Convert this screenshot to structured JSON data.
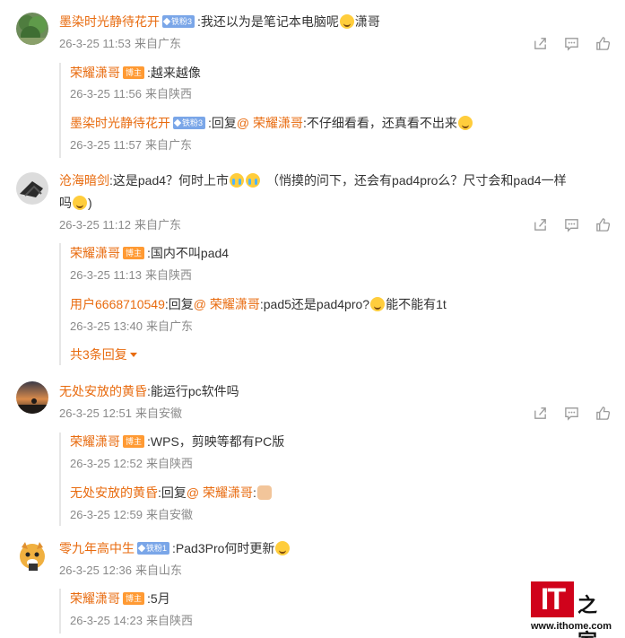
{
  "comments": [
    {
      "user": "墨染时光静待花开",
      "badge": "铁粉3",
      "text": "我还以为是笔记本电脑呢",
      "text_after": "潇哥",
      "time": "26-3-25 11:53",
      "location": "来自广东",
      "replies": [
        {
          "user": "荣耀潇哥",
          "badge": "博主",
          "text": "越来越像",
          "time": "26-3-25 11:56",
          "location": "来自陕西"
        },
        {
          "user": "墨染时光静待花开",
          "badge": "铁粉3",
          "reply_word": "回复",
          "mention": "@ 荣耀潇哥",
          "text": "不仔细看看，还真看不出来",
          "time": "26-3-25 11:57",
          "location": "来自广东"
        }
      ]
    },
    {
      "user": "沧海暗剑",
      "text": "这是pad4？何时上市",
      "text_after": "（悄摸的问下，还会有pad4pro么？尺寸会和pad4一样",
      "text_line2": "吗",
      "text_line2_after": ")",
      "time": "26-3-25 11:12",
      "location": "来自广东",
      "replies": [
        {
          "user": "荣耀潇哥",
          "badge": "博主",
          "text": "国内不叫pad4",
          "time": "26-3-25 11:13",
          "location": "来自陕西"
        },
        {
          "user": "用户6668710549",
          "reply_word": "回复",
          "mention": "@ 荣耀潇哥",
          "text": "pad5还是pad4pro?",
          "text_after": "能不能有1t",
          "time": "26-3-25 13:40",
          "location": "来自广东"
        }
      ],
      "more_replies": "共3条回复"
    },
    {
      "user": "无处安放的黄昏",
      "text": "能运行pc软件吗",
      "time": "26-3-25 12:51",
      "location": "来自安徽",
      "replies": [
        {
          "user": "荣耀潇哥",
          "badge": "博主",
          "text": "WPS，剪映等都有PC版",
          "time": "26-3-25 12:52",
          "location": "来自陕西"
        },
        {
          "user": "无处安放的黄昏",
          "reply_word": "回复",
          "mention": "@ 荣耀潇哥",
          "text": "",
          "time": "26-3-25 12:59",
          "location": "来自安徽"
        }
      ]
    },
    {
      "user": "零九年高中生",
      "badge": "铁粉1",
      "text": "Pad3Pro何时更新",
      "time": "26-3-25 12:36",
      "location": "来自山东",
      "replies": [
        {
          "user": "荣耀潇哥",
          "badge": "博主",
          "text": "5月",
          "time": "26-3-25 14:23",
          "location": "来自陕西"
        }
      ]
    }
  ],
  "icons": {
    "share": "share-icon",
    "comment": "comment-icon",
    "like": "thumbs-up-icon"
  },
  "watermark": {
    "brand": "IT",
    "char": "之家",
    "url": "www.ithome.com"
  },
  "colors": {
    "username": "#e86b0f",
    "meta": "#8a8a8a",
    "fan_badge": "#7aa6e8",
    "host_badge": "#ff9a33",
    "logo_red": "#d0021b"
  }
}
